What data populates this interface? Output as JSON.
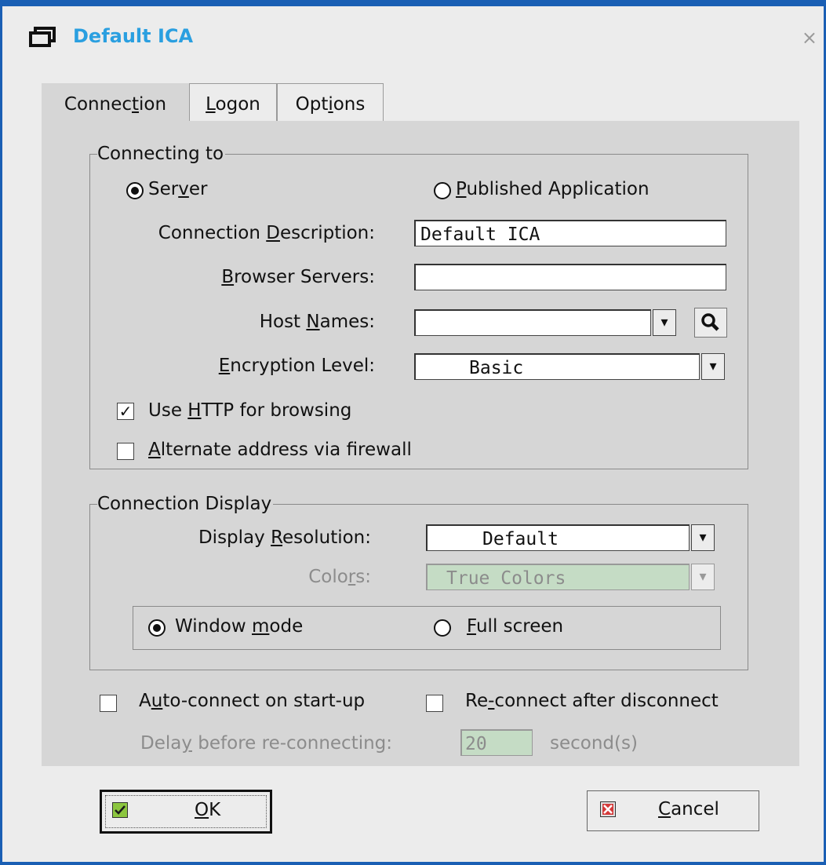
{
  "window": {
    "title": "Default ICA",
    "close_symbol": "×"
  },
  "tabs": [
    {
      "pre": "Connec",
      "u": "t",
      "post": "ion"
    },
    {
      "pre": "",
      "u": "L",
      "post": "ogon"
    },
    {
      "pre": "Opt",
      "u": "i",
      "post": "ons"
    }
  ],
  "connecting_to": {
    "legend": "Connecting to",
    "server": {
      "pre": "Ser",
      "u": "v",
      "post": "er"
    },
    "published_app": {
      "pre": "",
      "u": "P",
      "post": "ublished Application"
    },
    "desc_label": {
      "pre": "Connection ",
      "u": "D",
      "post": "escription:"
    },
    "desc_value": "Default ICA",
    "browser_label": {
      "pre": "",
      "u": "B",
      "post": "rowser Servers:"
    },
    "browser_value": "",
    "host_label": {
      "pre": "Host ",
      "u": "N",
      "post": "ames:"
    },
    "host_value": "",
    "enc_label": {
      "pre": "",
      "u": "E",
      "post": "ncryption Level:"
    },
    "enc_value": "Basic",
    "http": {
      "pre": "Use ",
      "u": "H",
      "post": "TTP for browsing",
      "checked_mark": "✓"
    },
    "alt": {
      "pre": "",
      "u": "A",
      "post": "lternate address via firewall"
    }
  },
  "display": {
    "legend": "Connection Display",
    "res_label": {
      "pre": "Display ",
      "u": "R",
      "post": "esolution:"
    },
    "res_value": "Default",
    "colors_label": {
      "pre": "Colo",
      "u": "r",
      "post": "s:"
    },
    "colors_value": "True Colors",
    "window_mode": {
      "pre": "Window ",
      "u": "m",
      "post": "ode"
    },
    "full_screen": {
      "pre": "",
      "u": "F",
      "post": "ull screen"
    }
  },
  "bottom": {
    "auto": {
      "pre": "A",
      "u": "u",
      "post": "to-connect on start-up"
    },
    "reconnect": {
      "pre": "Re",
      "u": "-",
      "post": "connect after disconnect"
    },
    "delay_label": {
      "pre": "Dela",
      "u": "y",
      "post": " before re-connecting:"
    },
    "delay_value": "20",
    "seconds": "second(s)"
  },
  "buttons": {
    "ok": {
      "pre": "",
      "u": "O",
      "post": "K"
    },
    "cancel": {
      "pre": "",
      "u": "C",
      "post": "ancel"
    }
  },
  "dropdown_symbol": "▾",
  "colors": {
    "title": "#2a9fe0",
    "frame": "#1a5fb4",
    "panel": "#d6d6d6",
    "disabled_field": "#c5dcc5"
  }
}
